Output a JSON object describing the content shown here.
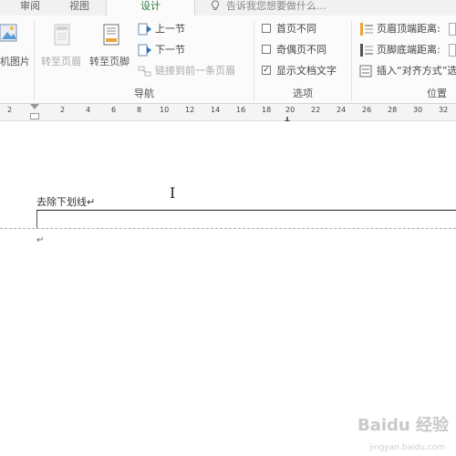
{
  "tabs": {
    "review": "审阅",
    "view": "视图",
    "design": "设计"
  },
  "tellme": {
    "placeholder": "告诉我您想要做什么..."
  },
  "ribbon": {
    "insert_partial": "机图片",
    "goto_header": "转至页眉",
    "goto_footer": "转至页脚",
    "prev_section": "上一节",
    "next_section": "下一节",
    "link_previous": "链接到前一条页眉",
    "nav_group": "导航",
    "first_page_diff": "首页不同",
    "odd_even_diff": "奇偶页不同",
    "show_doc_text": "显示文档文字",
    "show_doc_text_checked": true,
    "options_group": "选项",
    "header_from_top": "页眉顶端距离:",
    "footer_from_bottom": "页脚底端距离:",
    "insert_align_tab": "插入“对齐方式”选",
    "position_group": "位置"
  },
  "ruler": {
    "ticks": [
      "2",
      "2",
      "4",
      "6",
      "8",
      "10",
      "12",
      "14",
      "16",
      "18",
      "20",
      "22",
      "24",
      "26",
      "28",
      "30",
      "32"
    ]
  },
  "document": {
    "header_text": "去除下划线↵",
    "para_mark": "↵"
  },
  "watermark": {
    "logo": "Baidu 经验",
    "url": "jingyan.baidu.com"
  },
  "colors": {
    "accent_green": "#2b7a3b",
    "ribbon_bg": "#fbfbfb",
    "tabbar_bg": "#f1f1f1",
    "boundary_dash": "#9cb0c4"
  }
}
